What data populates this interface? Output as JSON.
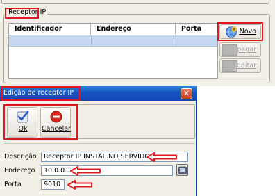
{
  "receptor_group": {
    "title": "Receptor IP",
    "columns": [
      "Identificador",
      "Endereço",
      "Porta"
    ]
  },
  "side_buttons": {
    "novo": "Novo",
    "apagar": "Apagar",
    "editar": "Editar"
  },
  "dialog": {
    "title": "Edição de receptor IP",
    "close_glyph": "✕",
    "toolbar": {
      "ok": "Ok",
      "cancelar": "Cancelar"
    },
    "fields": {
      "descricao_label": "Descrição",
      "descricao_value": "Receptor IP INSTAL.NO SERVIDOR",
      "endereco_label": "Endereço",
      "endereco_value": "10.0.0.1",
      "porta_label": "Porta",
      "porta_value": "9010"
    }
  },
  "colors": {
    "annotation_red": "#e0171c",
    "selection_row": "#c5d6ee",
    "titlebar_blue": "#1553c1"
  },
  "icons": [
    "globe-add-icon",
    "delete-icon",
    "edit-icon",
    "ok-check-icon",
    "cancel-icon",
    "close-icon",
    "lookup-icon",
    "arrow-annotation-icon"
  ]
}
